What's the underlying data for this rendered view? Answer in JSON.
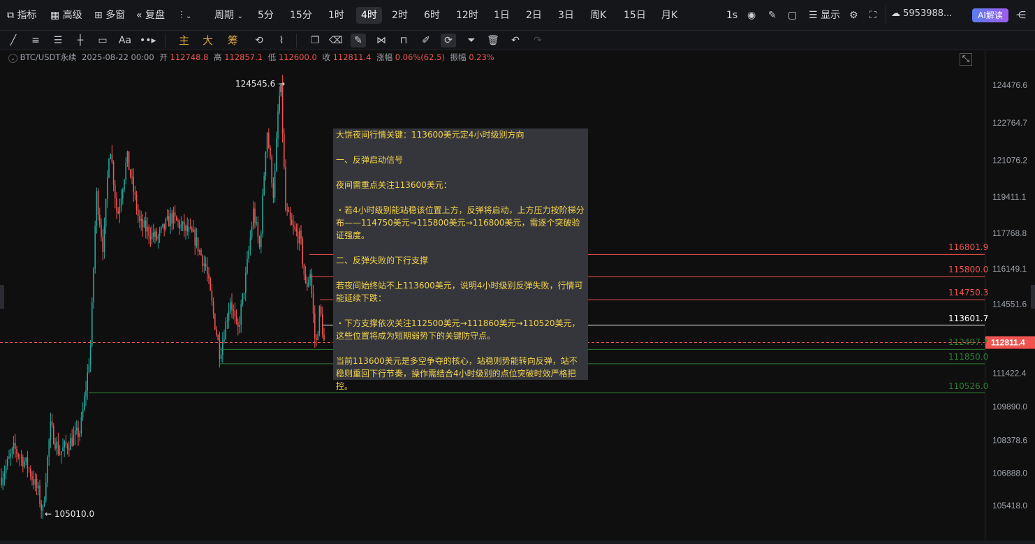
{
  "topbar": {
    "indicators_label": "指标",
    "advanced_label": "高级",
    "multiwindow_label": "多窗",
    "replay_label": "复盘",
    "period_label": "周期",
    "timeframes": [
      "5分",
      "15分",
      "1时",
      "4时",
      "2时",
      "6时",
      "12时",
      "1日",
      "2日",
      "3日",
      "周K",
      "15日",
      "月K"
    ],
    "active_timeframe": "4时",
    "interval_label": "1s",
    "display_label": "显示",
    "account_value": "5953988...",
    "ai_button": "AI解读"
  },
  "toolbar": {
    "font_tool_label": "Aa",
    "main_label": "主",
    "big_label": "大",
    "chip_label": "筹"
  },
  "info_bar": {
    "symbol": "BTC/USDT永续",
    "datetime": "2025-08-22 00:00",
    "open_label": "开",
    "open_value": "112748.8",
    "high_label": "高",
    "high_value": "112857.1",
    "low_label": "低",
    "low_value": "112600.0",
    "close_label": "收",
    "close_value": "112811.4",
    "change_label": "涨幅",
    "change_value": "0.06%(62.5)",
    "amplitude_label": "振幅",
    "amplitude_value": "0.23%"
  },
  "chart_data": {
    "type": "candlestick",
    "symbol": "BTC/USDT永续",
    "timeframe": "4时",
    "ylim": [
      104500,
      125500
    ],
    "y_ticks": [
      "124476.6",
      "122764.7",
      "121076.2",
      "119411.1",
      "117768.8",
      "116149.1",
      "114551.6",
      "112811.4",
      "111422.4",
      "109890.0",
      "108378.6",
      "106888.0",
      "105418.0"
    ],
    "last_price": "112811.4",
    "max_label": "124545.6",
    "min_label": "105010.0",
    "colors": {
      "up": "#26a69a",
      "down": "#ef5350",
      "background": "#0f0f10"
    },
    "levels": [
      {
        "label": "116801.9",
        "value": 116801.9,
        "color": "#ef5350"
      },
      {
        "label": "115800.0",
        "value": 115800.0,
        "color": "#ef5350"
      },
      {
        "label": "114750.3",
        "value": 114750.3,
        "color": "#ef5350"
      },
      {
        "label": "113601.7",
        "value": 113601.7,
        "color": "#ffffff"
      },
      {
        "label": "112497.7",
        "value": 112497.7,
        "color": "#2e7d32"
      },
      {
        "label": "111850.0",
        "value": 111850.0,
        "color": "#2e7d32"
      },
      {
        "label": "110526.0",
        "value": 110526.0,
        "color": "#2e7d32"
      }
    ]
  },
  "note": {
    "title": "大饼夜间行情关键：113600美元定4小时级别方向",
    "s1_title": "一、反弹启动信号",
    "s1_intro": "夜间需重点关注113600美元：",
    "s1_bullet": "・若4小时级别能站稳该位置上方，反弹将启动，上方压力按阶梯分布——114750美元→115800美元→116800美元，需逐个突破验证强度。",
    "s2_title": "二、反弹失败的下行支撑",
    "s2_intro": "若夜间始终站不上113600美元，说明4小时级别反弹失败，行情可能延续下跌：",
    "s2_bullet": "・下方支撑依次关注112500美元→111860美元→110520美元，这些位置将成为短期弱势下的关键防守点。",
    "conclusion": "当前113600美元是多空争夺的核心，站稳则势能转向反弹，站不稳则重回下行节奏，操作需结合4小时级别的点位突破时效严格把控。"
  }
}
